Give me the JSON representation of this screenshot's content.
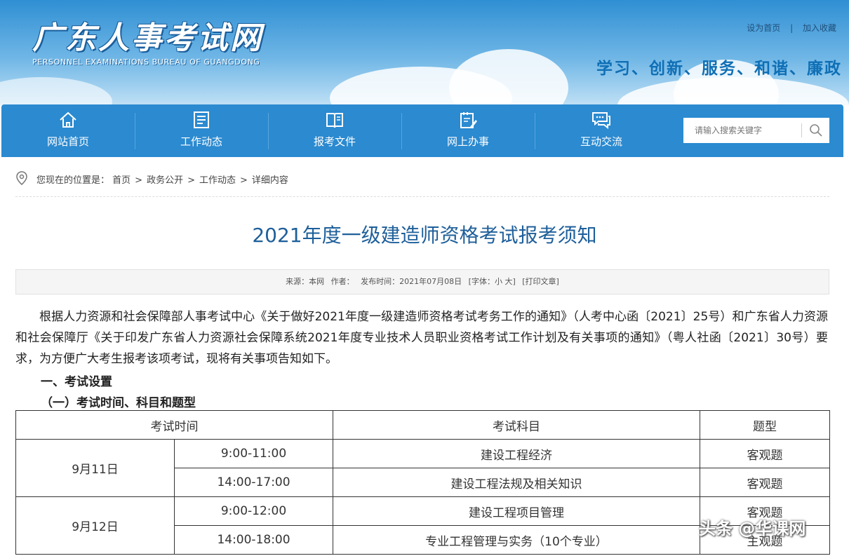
{
  "header": {
    "logo_cn": "广东人事考试网",
    "logo_en": "PERSONNEL EXAMINATIONS BUREAU OF GUANGDONG",
    "set_homepage": "设为首页",
    "separator": "|",
    "add_favorite": "加入收藏",
    "slogan": "学习、创新、服务、和谐、廉政"
  },
  "nav": {
    "items": [
      {
        "label": "网站首页",
        "icon": "home-icon"
      },
      {
        "label": "工作动态",
        "icon": "list-icon"
      },
      {
        "label": "报考文件",
        "icon": "book-icon"
      },
      {
        "label": "网上办事",
        "icon": "edit-icon"
      },
      {
        "label": "互动交流",
        "icon": "chat-icon"
      }
    ],
    "search_placeholder": "请输入搜索关键字"
  },
  "breadcrumb": {
    "prefix": "您现在的位置是：",
    "items": [
      "首页",
      "政务公开",
      "工作动态",
      "详细内容"
    ],
    "arrow": ">"
  },
  "article": {
    "title": "2021年度一级建造师资格考试报考须知",
    "meta": {
      "source": "来源：本网",
      "author": "作者：",
      "publish_time": "发布时间：2021年07月08日",
      "font_size": "[字体：小 大]",
      "print": "[打印文章]"
    },
    "intro": "根据人力资源和社会保障部人事考试中心《关于做好2021年度一级建造师资格考试考务工作的通知》（人考中心函〔2021〕25号）和广东省人力资源和社会保障厅《关于印发广东省人力资源社会保障系统2021年度专业技术人员职业资格考试工作计划及有关事项的通知》（粤人社函〔2021〕30号）要求，为方便广大考生报考该项考试，现将有关事项告知如下。",
    "section1": "一、考试设置",
    "section1_1": "（一）考试时间、科目和题型"
  },
  "exam_table": {
    "headers": [
      "考试时间",
      "考试科目",
      "题型"
    ],
    "days": [
      {
        "date": "9月11日",
        "rows": [
          {
            "time": "9:00-11:00",
            "subject": "建设工程经济",
            "type": "客观题"
          },
          {
            "time": "14:00-17:00",
            "subject": "建设工程法规及相关知识",
            "type": "客观题"
          }
        ]
      },
      {
        "date": "9月12日",
        "rows": [
          {
            "time": "9:00-12:00",
            "subject": "建设工程项目管理",
            "type": "客观题"
          },
          {
            "time": "14:00-18:00",
            "subject": "专业工程管理与实务（10个专业）",
            "type": "主观题"
          }
        ]
      }
    ]
  },
  "watermark": "头条 @华课网"
}
